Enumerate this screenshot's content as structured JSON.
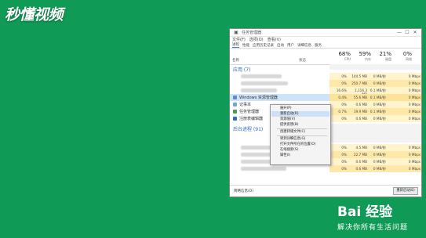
{
  "brand": {
    "logo": "秒懂视频"
  },
  "watermark": {
    "logo": "Bai 经验",
    "subtitle": "解决你所有生活问题"
  },
  "window": {
    "title": "任务管理器",
    "controls": {
      "minimize": "—",
      "maximize": "☐",
      "close": "✕"
    },
    "menu": [
      "文件(F)",
      "选项(O)",
      "查看(V)"
    ],
    "tabs": [
      "进程",
      "性能",
      "应用历史记录",
      "启动",
      "用户",
      "详细信息",
      "服务"
    ],
    "columns": {
      "name": "名称",
      "status": "状态",
      "metrics": [
        {
          "pct": "68%",
          "label": "CPU"
        },
        {
          "pct": "59%",
          "label": "内存"
        },
        {
          "pct": "21%",
          "label": "磁盘"
        },
        {
          "pct": "0%",
          "label": "网络"
        }
      ]
    },
    "sections": {
      "apps": "应用 (7)",
      "background": "后台进程 (91)"
    },
    "app_rows": [
      {
        "name": "",
        "values": [
          "0%",
          "144.5 MB",
          "0 MB/秒",
          "0 Mbps"
        ]
      },
      {
        "name": "",
        "values": [
          "0%",
          "250.7 MB",
          "0 MB/秒",
          "0 Mbps"
        ]
      },
      {
        "name": "",
        "values": [
          "16.6%",
          "1,116.3 MB",
          "0.1 MB/秒",
          "0 Mbps"
        ]
      },
      {
        "name": "Windows 资源管理器",
        "values": [
          "0.4%",
          "55.6 MB",
          "0.1 MB/秒",
          "0 Mbps"
        ]
      },
      {
        "name": "记事本",
        "values": [
          "0%",
          "0.6 MB",
          "0 MB/秒",
          "0 Mbps"
        ]
      },
      {
        "name": "任务管理器",
        "values": [
          "0.7%",
          "19.9 MB",
          "0.1 MB/秒",
          "0 Mbps"
        ]
      },
      {
        "name": "注册表编辑器",
        "values": [
          "0%",
          "0.6 MB",
          "0 MB/秒",
          "0 Mbps"
        ]
      }
    ],
    "bg_rows": [
      {
        "values": [
          "0%",
          "4.5 MB",
          "0 MB/秒",
          "0 Mbps"
        ]
      },
      {
        "values": [
          "0%",
          "22.7 MB",
          "0 MB/秒",
          "0 Mbps"
        ]
      },
      {
        "values": [
          "0%",
          "0.6 MB",
          "0 MB/秒",
          "0 Mbps"
        ]
      },
      {
        "values": [
          "0%",
          "0.6 MB",
          "0 MB/秒",
          "0 Mbps"
        ]
      }
    ],
    "footer": {
      "fewer_details": "简略信息(D)",
      "end_task": "重新启动(E)"
    }
  },
  "context_menu": {
    "items": [
      "展开(P)",
      "重新启动(R)",
      "资源值(V)",
      "提供反馈(B)",
      "创建转储文件(C)",
      "转到详细信息(G)",
      "打开文件所在的位置(O)",
      "在线搜索(S)",
      "属性(I)"
    ],
    "highlighted_index": 1
  }
}
